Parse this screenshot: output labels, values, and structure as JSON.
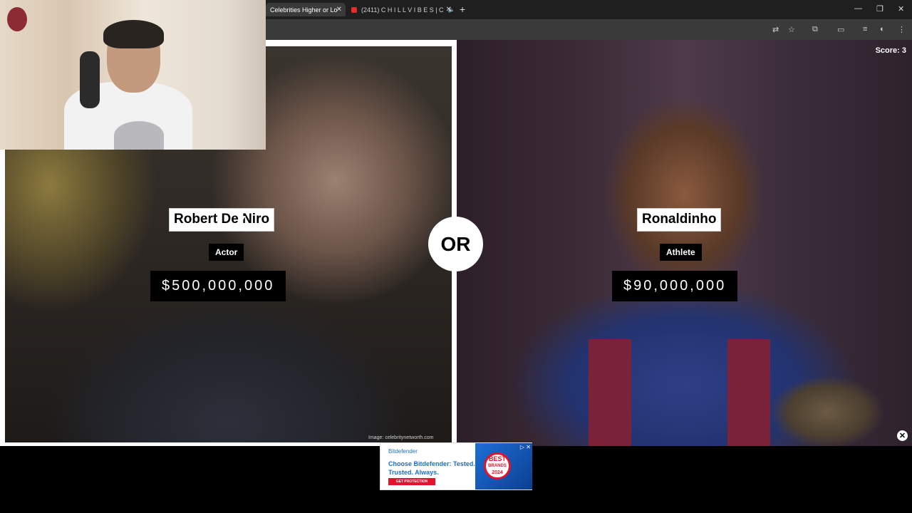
{
  "browser": {
    "tabs": [
      {
        "title": "Celebrities Higher or Lo"
      },
      {
        "title": "(2411) C H I L L V I B E S | C"
      }
    ],
    "new_tab_glyph": "+",
    "window_controls": [
      "—",
      "❐",
      "✕"
    ]
  },
  "game": {
    "score_label": "Score: 3",
    "or_label": "OR",
    "left": {
      "name": "Robert De Niro",
      "category": "Actor",
      "net_worth": "$500,000,000",
      "credit": "Image: celebritynetworth.com"
    },
    "right": {
      "name": "Ronaldinho",
      "category": "Athlete",
      "net_worth": "$90,000,000"
    }
  },
  "ad": {
    "brand": "Bitdefender",
    "headline": "Choose Bitdefender: Tested. Trusted. Always.",
    "cta": "GET PROTECTION",
    "badge_line1": "BEST",
    "badge_line2": "BRANDS",
    "badge_line3": "2024",
    "info": "▷ ✕"
  },
  "colors": {
    "accent_red": "#e4132b",
    "ad_blue": "#1a6fd6"
  }
}
